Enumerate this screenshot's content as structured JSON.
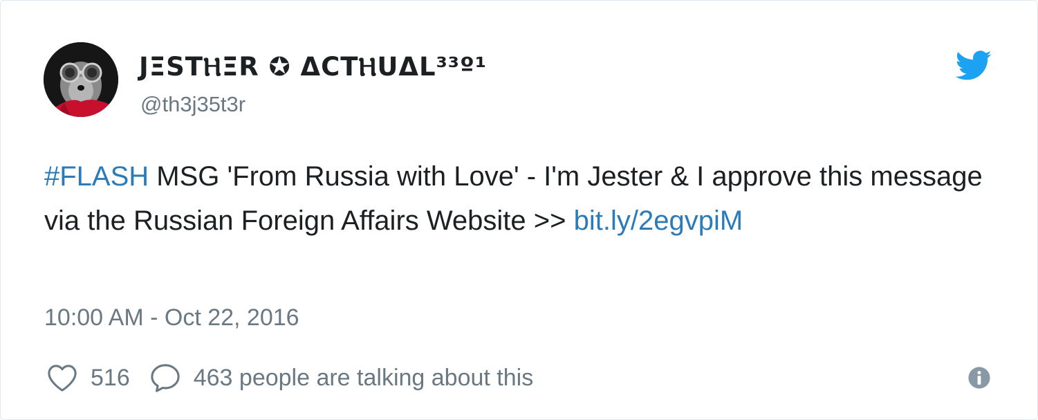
{
  "user": {
    "display_name": "JΞSTⲎΞR ✪ ΔCTⲎUΔL³³º¹",
    "handle": "@th3j35t3r",
    "avatar_icon": "avatar-dog-with-goggles"
  },
  "brand": {
    "icon": "twitter-bird-icon",
    "color": "#1da1f2"
  },
  "tweet": {
    "hashtag": "#FLASH",
    "text": " MSG 'From Russia with Love' - I'm Jester & I approve this message via the Russian Foreign Affairs Website >> ",
    "link": "bit.ly/2egvpiM",
    "link_color": "#2b7bb9",
    "timestamp": "10:00 AM - Oct 22, 2016"
  },
  "actions": {
    "likes": "516",
    "replies_text": "463 people are talking about this",
    "like_icon": "heart-icon",
    "reply_icon": "speech-bubble-icon",
    "info_icon": "info-icon"
  }
}
